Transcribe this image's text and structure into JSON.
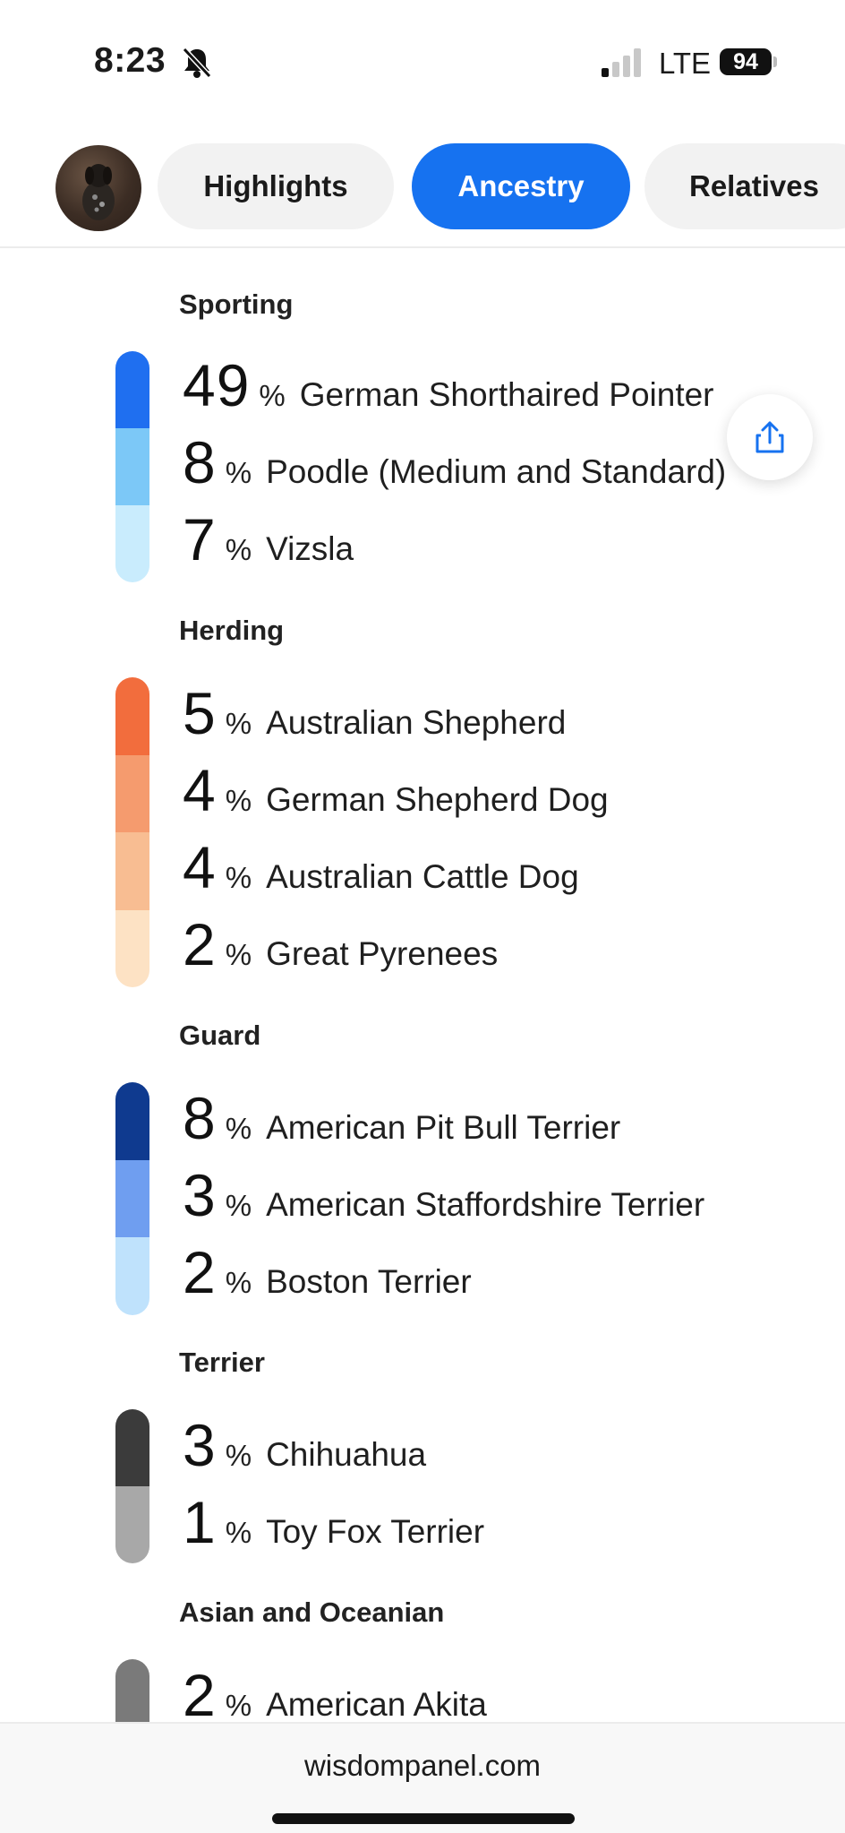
{
  "status_bar": {
    "time": "8:23",
    "network": "LTE",
    "battery": "94",
    "icons": [
      "bell-slash-icon",
      "signal-icon"
    ]
  },
  "tabs": [
    {
      "label": "Highlights",
      "active": false
    },
    {
      "label": "Ancestry",
      "active": true
    },
    {
      "label": "Relatives",
      "active": false
    }
  ],
  "groups": [
    {
      "title": "Sporting",
      "breeds": [
        {
          "pct": "49",
          "name": "German Shorthaired Pointer",
          "color": "#1f6ff0"
        },
        {
          "pct": "8",
          "name": "Poodle (Medium and Standard)",
          "color": "#7cc8f7"
        },
        {
          "pct": "7",
          "name": "Vizsla",
          "color": "#c9ecfd"
        }
      ]
    },
    {
      "title": "Herding",
      "breeds": [
        {
          "pct": "5",
          "name": "Australian Shepherd",
          "color": "#f26d3d"
        },
        {
          "pct": "4",
          "name": "German Shepherd Dog",
          "color": "#f59b6e"
        },
        {
          "pct": "4",
          "name": "Australian Cattle Dog",
          "color": "#f8bd92"
        },
        {
          "pct": "2",
          "name": "Great Pyrenees",
          "color": "#fde2c4"
        }
      ]
    },
    {
      "title": "Guard",
      "breeds": [
        {
          "pct": "8",
          "name": "American Pit Bull Terrier",
          "color": "#0f3a8f"
        },
        {
          "pct": "3",
          "name": "American Staffordshire Terrier",
          "color": "#6f9ef0"
        },
        {
          "pct": "2",
          "name": "Boston Terrier",
          "color": "#bfe2fc"
        }
      ]
    },
    {
      "title": "Terrier",
      "breeds": [
        {
          "pct": "3",
          "name": "Chihuahua",
          "color": "#3b3b3b"
        },
        {
          "pct": "1",
          "name": "Toy Fox Terrier",
          "color": "#a8a8a8"
        }
      ]
    },
    {
      "title": "Asian and Oceanian",
      "breeds": [
        {
          "pct": "2",
          "name": "American Akita",
          "color": "#7a7a7a"
        }
      ]
    }
  ],
  "pct_sign": "%",
  "share_icon": "share-icon",
  "url": "wisdompanel.com"
}
